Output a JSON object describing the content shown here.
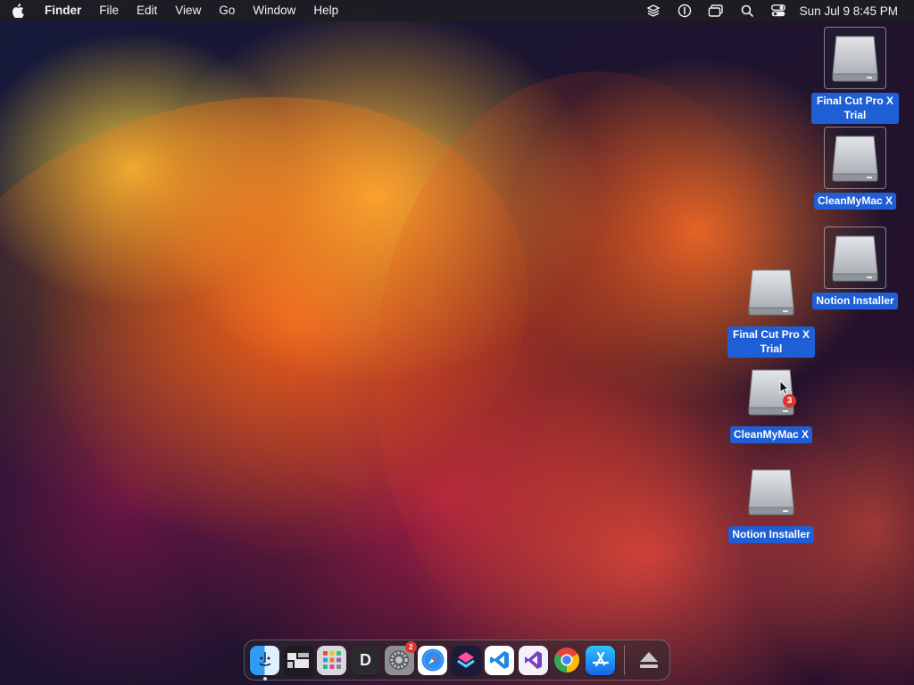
{
  "menubar": {
    "apple_icon": "apple-logo-icon",
    "app_name": "Finder",
    "menus": [
      "File",
      "Edit",
      "View",
      "Go",
      "Window",
      "Help"
    ],
    "tray_icons": [
      "stack-icon",
      "password-icon",
      "windows-icon",
      "spotlight-search-icon",
      "control-center-icon"
    ],
    "clock": "Sun Jul 9  8:45 PM"
  },
  "desktop": {
    "icons": [
      {
        "label": "Final Cut Pro X Trial",
        "icon": "disk-image-icon",
        "selected": true
      },
      {
        "label": "CleanMyMac X",
        "icon": "disk-image-icon",
        "selected": true
      },
      {
        "label": "Notion Installer",
        "icon": "disk-image-icon",
        "selected": true
      },
      {
        "label": "Final Cut Pro X Trial",
        "icon": "disk-image-icon",
        "selected": false
      },
      {
        "label": "CleanMyMac X",
        "icon": "disk-image-icon",
        "selected": false,
        "badge": "3"
      },
      {
        "label": "Notion Installer",
        "icon": "disk-image-icon",
        "selected": false
      }
    ]
  },
  "dock": {
    "apps": [
      {
        "name": "Finder",
        "icon": "finder-icon",
        "running": true
      },
      {
        "name": "Desktop app",
        "icon": "window-layout-icon"
      },
      {
        "name": "Launchpad",
        "icon": "launchpad-icon"
      },
      {
        "name": "D app",
        "icon": "d-letter-icon",
        "letter": "D"
      },
      {
        "name": "System Settings",
        "icon": "settings-gear-icon",
        "badge": "2"
      },
      {
        "name": "Safari",
        "icon": "safari-compass-icon"
      },
      {
        "name": "Shortcuts",
        "icon": "shortcuts-icon"
      },
      {
        "name": "Visual Studio Code",
        "icon": "vscode-icon"
      },
      {
        "name": "Visual Studio",
        "icon": "visual-studio-icon"
      },
      {
        "name": "Google Chrome",
        "icon": "chrome-icon"
      },
      {
        "name": "App Store",
        "icon": "app-store-icon"
      },
      {
        "name": "Eject",
        "icon": "eject-icon"
      }
    ]
  }
}
